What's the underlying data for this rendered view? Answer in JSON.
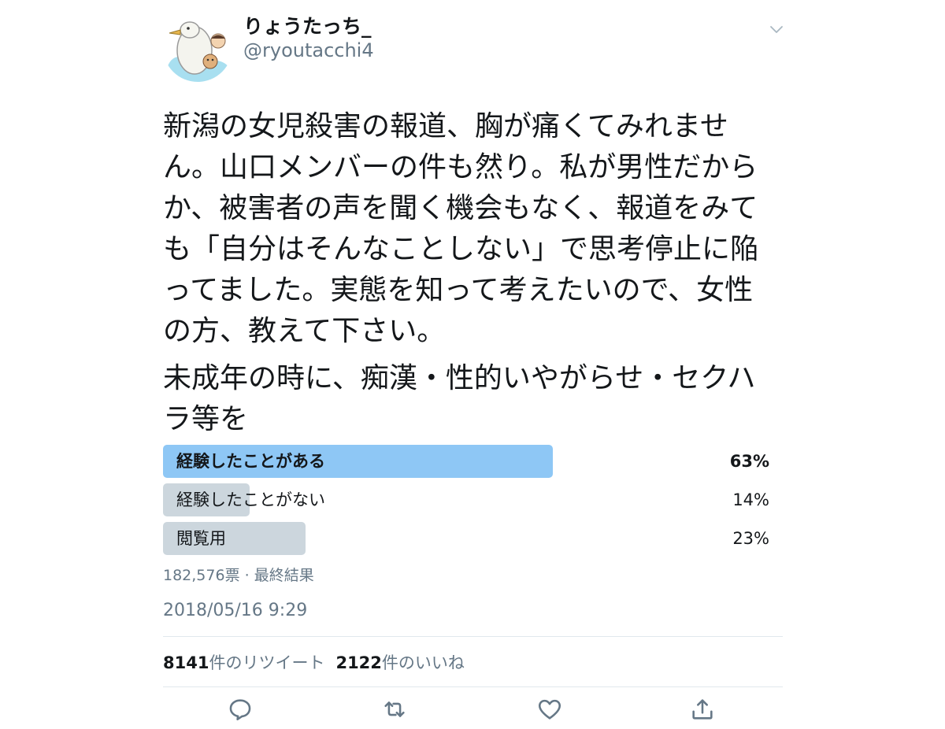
{
  "user": {
    "display_name": "りょうたっち_",
    "handle": "@ryoutacchi4"
  },
  "tweet": {
    "paragraph1": "新潟の女児殺害の報道、胸が痛くてみれません。山口メンバーの件も然り。私が男性だからか、被害者の声を聞く機会もなく、報道をみても「自分はそんなことしない」で思考停止に陥ってました。実態を知って考えたいので、女性の方、教えて下さい。",
    "paragraph2": "未成年の時に、痴漢・性的いやがらせ・セクハラ等を"
  },
  "poll": {
    "options": [
      {
        "label": "経験したことがある",
        "percent_text": "63%",
        "fill": 0.63
      },
      {
        "label": "経験したことがない",
        "percent_text": "14%",
        "fill": 0.14
      },
      {
        "label": "閲覧用",
        "percent_text": "23%",
        "fill": 0.23
      }
    ],
    "meta": "182,576票 · 最終結果"
  },
  "timestamp": "2018/05/16 9:29",
  "stats": {
    "retweets_count": "8141",
    "retweets_label": "件のリツイート",
    "likes_count": "2122",
    "likes_label": "件のいいね"
  },
  "colors": {
    "poll_winner": "#8ec7f5",
    "poll_other": "#ccd6dd",
    "secondary_text": "#657786",
    "icon": "#657786"
  },
  "icons": [
    "chevron-down-icon",
    "reply-icon",
    "retweet-icon",
    "like-icon",
    "share-icon"
  ]
}
